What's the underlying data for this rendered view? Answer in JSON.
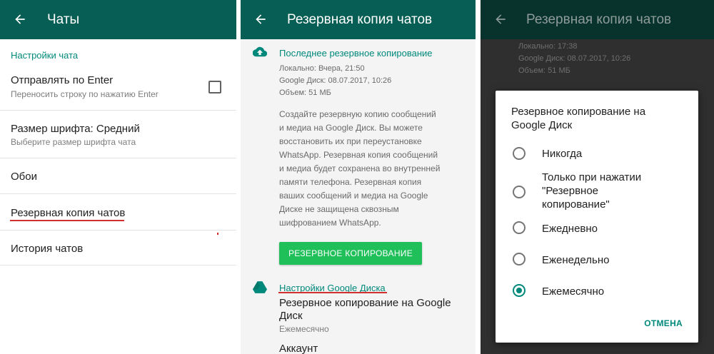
{
  "screen1": {
    "title": "Чаты",
    "section": "Настройки чата",
    "enter": {
      "label": "Отправлять по Enter",
      "sub": "Переносить строку по нажатию Enter"
    },
    "font": {
      "label": "Размер шрифта: Средний",
      "sub": "Выберите размер шрифта чата"
    },
    "wallpaper": "Обои",
    "backup": "Резервная копия чатов",
    "history": "История чатов"
  },
  "screen2": {
    "title": "Резервная копия чатов",
    "last_backup_head": "Последнее резервное копирование",
    "local": "Локально: Вчера, 21:50",
    "gdrive": "Google Диск: 08.07.2017, 10:26",
    "size": "Объем: 51 МБ",
    "desc_lines": [
      "Создайте резервную копию сообщений",
      "и медиа на Google Диск. Вы можете",
      "восстановить их при переустановке",
      "WhatsApp. Резервная копия сообщений",
      "и медиа будет сохранена во внутренней",
      "памяти телефона. Резервная копия",
      "ваших сообщений и медиа на Google",
      "Диске не защищена сквозным",
      "шифрованием WhatsApp."
    ],
    "button": "РЕЗЕРВНОЕ КОПИРОВАНИЕ",
    "gd_settings_head": "Настройки Google Диска",
    "gd_backup_label_1": "Резервное копирование на Google",
    "gd_backup_label_2": "Диск",
    "gd_backup_value": "Ежемесячно",
    "account": "Аккаунт"
  },
  "screen3": {
    "title": "Резервная копия чатов",
    "bg_local": "Локально: 17:38",
    "bg_gdrive": "Google Диск: 08.07.2017, 10:26",
    "bg_size": "Объем: 51 МБ",
    "dialog": {
      "title": "Резервное копирование на Google Диск",
      "options": [
        "Никогда",
        "Только при нажатии",
        "\"Резервное",
        "копирование\"",
        "Ежедневно",
        "Еженедельно",
        "Ежемесячно"
      ],
      "selected": "Ежемесячно",
      "cancel": "ОТМЕНА"
    }
  },
  "colors": {
    "toolbar": "#075e54",
    "accent": "#00897b",
    "button": "#1fbf5a",
    "underline": "#d32f2f"
  }
}
